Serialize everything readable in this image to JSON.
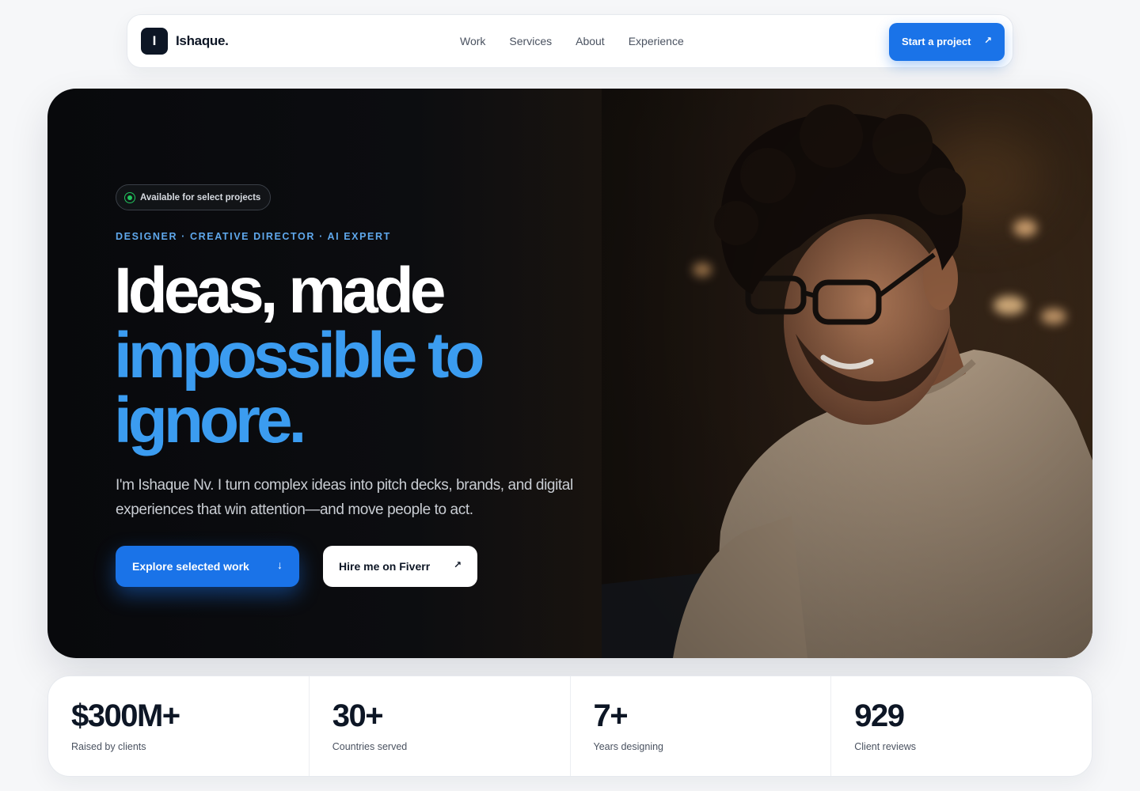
{
  "nav": {
    "logo_letter": "I",
    "brand": "Ishaque.",
    "links": [
      "Work",
      "Services",
      "About",
      "Experience"
    ],
    "cta_label": "Start a project",
    "cta_icon": "arrow-up-right-icon"
  },
  "hero": {
    "badge": "Available for select projects",
    "roles": "DESIGNER · CREATIVE DIRECTOR · AI EXPERT",
    "headline_line1": "Ideas, made",
    "headline_line2": "impossible to",
    "headline_line3": "ignore.",
    "subtext": "I'm Ishaque Nv. I turn complex ideas into pitch decks, brands, and digital experiences that win attention—and move people to act.",
    "primary_button": "Explore selected work",
    "primary_icon": "arrow-down-icon",
    "secondary_button": "Hire me on Fiverr",
    "secondary_icon": "arrow-up-right-icon"
  },
  "stats": [
    {
      "value": "$300M+",
      "label": "Raised by clients"
    },
    {
      "value": "30+",
      "label": "Countries served"
    },
    {
      "value": "7+",
      "label": "Years designing"
    },
    {
      "value": "929",
      "label": "Client reviews"
    }
  ],
  "colors": {
    "accent": "#1a73e8",
    "headline_blue": "#3b9cf0",
    "role_blue": "#5fa8ec",
    "status_green": "#22c55e",
    "dark": "#0d1625"
  }
}
